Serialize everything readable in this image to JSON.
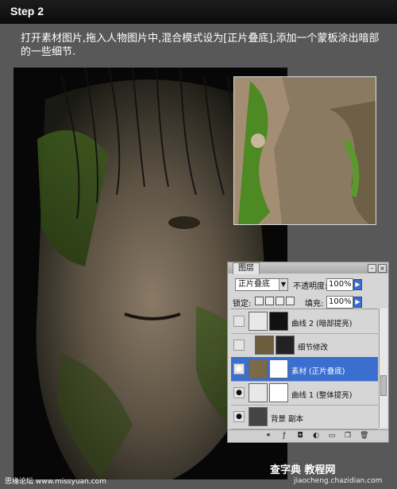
{
  "header": {
    "step_title": "Step 2"
  },
  "instruction": "打开素材图片,拖入人物图片中,混合模式设为[正片叠底],添加一个蒙板涂出暗部的一些细节.",
  "layers_panel": {
    "tab_label": "图层",
    "blend_mode": "正片叠底",
    "opacity_label": "不透明度:",
    "opacity_value": "100%",
    "lock_label": "锁定:",
    "fill_label": "填充:",
    "fill_value": "100%",
    "layers": [
      {
        "name": "曲线 2 (暗部提亮)",
        "visible": false,
        "selected": false
      },
      {
        "name": "细节修改",
        "visible": false,
        "selected": false
      },
      {
        "name": "素材 (正片叠底)",
        "visible": true,
        "selected": true
      },
      {
        "name": "曲线 1 (整体提亮)",
        "visible": true,
        "selected": false
      },
      {
        "name": "背景 副本",
        "visible": true,
        "selected": false
      }
    ]
  },
  "watermarks": {
    "left": "思缘论坛 www.missyuan.com",
    "right_title": "查字典 教程网",
    "right_url": "jiaocheng.chazidian.com"
  }
}
